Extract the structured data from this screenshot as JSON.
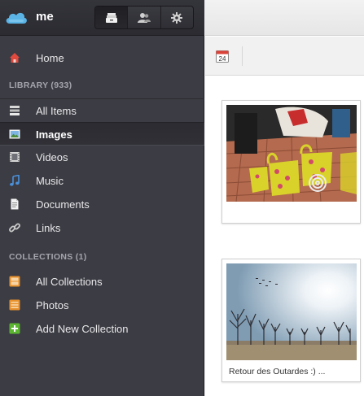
{
  "header": {
    "user_name": "me",
    "buttons": [
      {
        "name": "inbox-icon"
      },
      {
        "name": "people-icon"
      },
      {
        "name": "gear-icon"
      }
    ]
  },
  "nav": {
    "home": {
      "label": "Home",
      "icon": "home-icon"
    },
    "library_title": "LIBRARY (933)",
    "library_items": [
      {
        "label": "All Items",
        "icon": "stack-icon"
      },
      {
        "label": "Images",
        "icon": "image-icon"
      },
      {
        "label": "Videos",
        "icon": "film-icon"
      },
      {
        "label": "Music",
        "icon": "music-note-icon"
      },
      {
        "label": "Documents",
        "icon": "document-icon"
      },
      {
        "label": "Links",
        "icon": "link-icon"
      }
    ],
    "collections_title": "COLLECTIONS (1)",
    "collection_items": [
      {
        "label": "All Collections",
        "icon": "collection-icon"
      },
      {
        "label": "Photos",
        "icon": "collection-icon"
      },
      {
        "label": "Add New Collection",
        "icon": "plus-icon"
      }
    ]
  },
  "toolbar": {
    "calendar_day": "24"
  },
  "cards": [
    {
      "caption": ""
    },
    {
      "caption": "Retour des Outardes :) ..."
    }
  ],
  "colors": {
    "sidebar_bg": "#3c3c44",
    "home_icon": "#d9433a",
    "collection_icon": "#e8922e",
    "add_icon": "#5cb531",
    "music_icon": "#4a90d9"
  }
}
